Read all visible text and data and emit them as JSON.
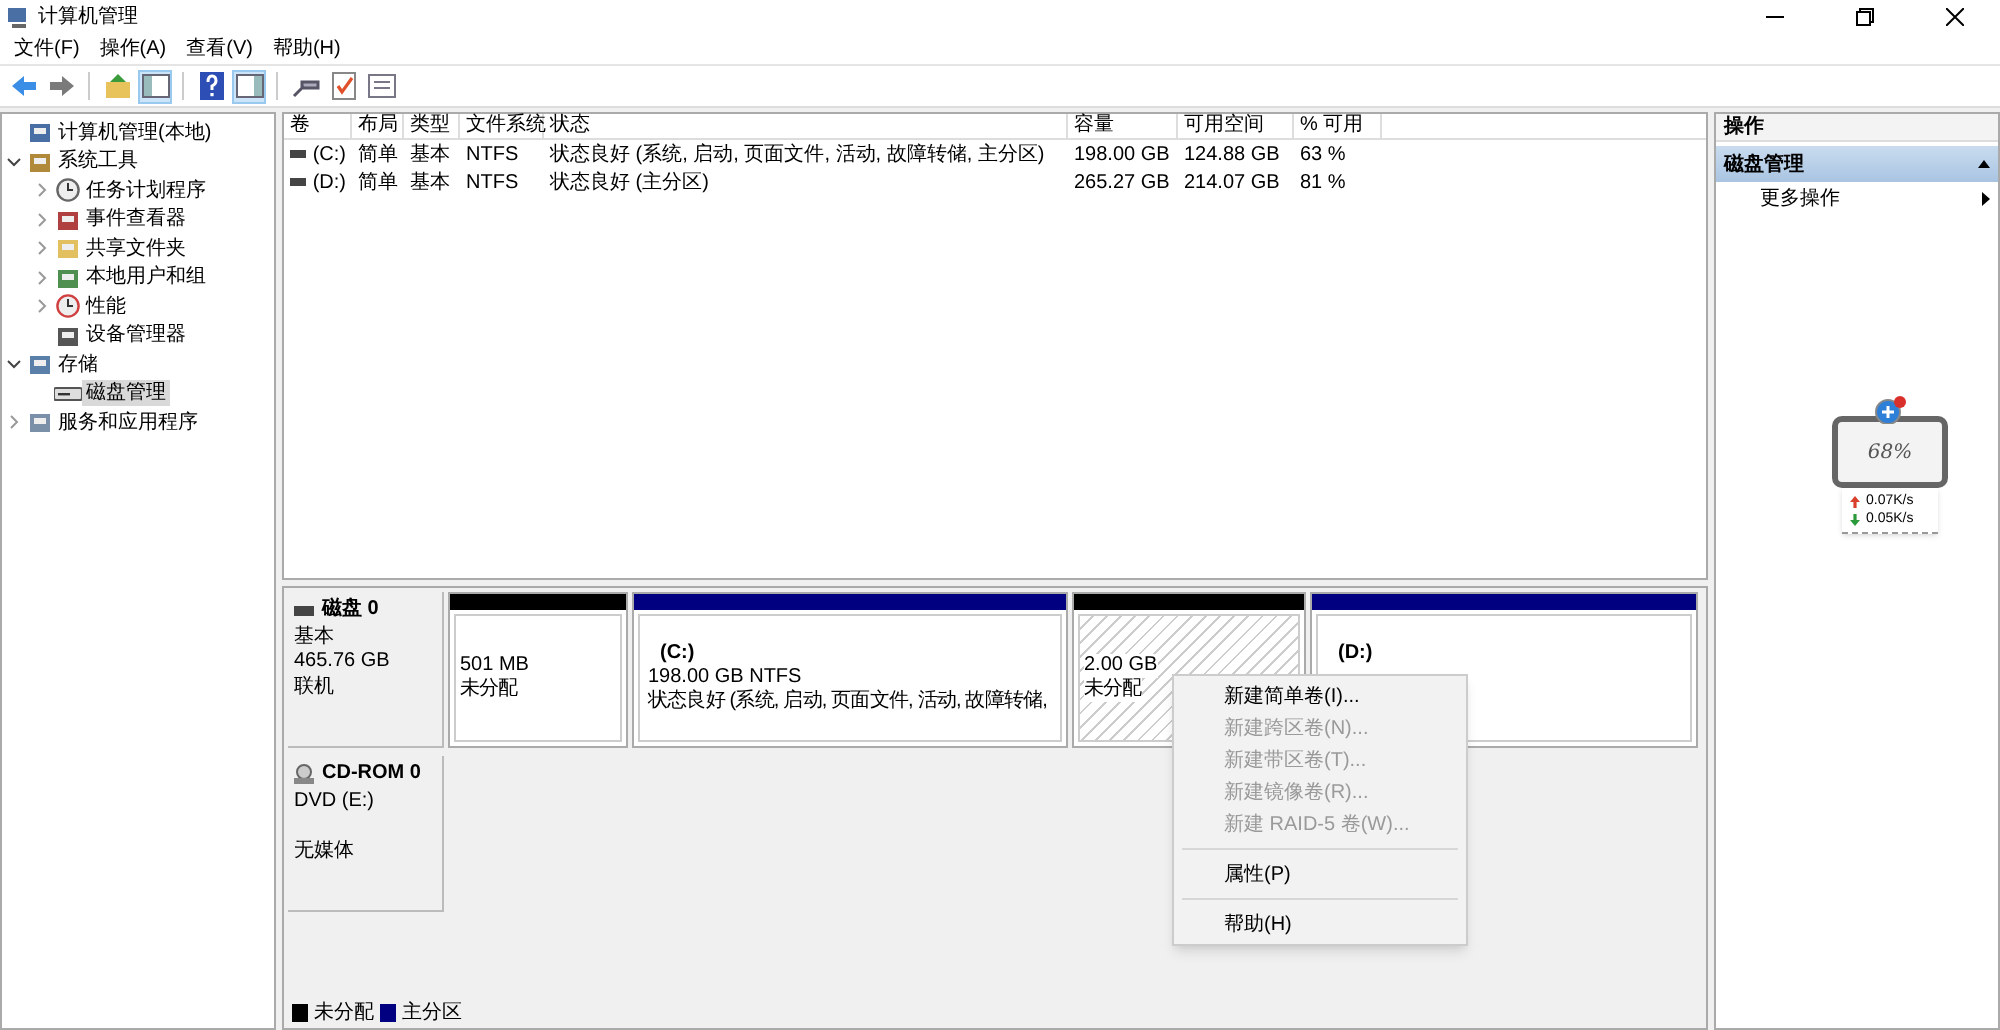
{
  "window": {
    "title": "计算机管理"
  },
  "menu_bar": [
    "文件(F)",
    "操作(A)",
    "查看(V)",
    "帮助(H)"
  ],
  "toolbar": [
    {
      "kind": "back",
      "selected": false
    },
    {
      "kind": "forward",
      "selected": false
    },
    {
      "kind": "separator"
    },
    {
      "kind": "up",
      "selected": false
    },
    {
      "kind": "tree",
      "selected": true
    },
    {
      "kind": "separator"
    },
    {
      "kind": "help",
      "selected": false
    },
    {
      "kind": "pane",
      "selected": true
    },
    {
      "kind": "separator"
    },
    {
      "kind": "connect",
      "selected": false
    },
    {
      "kind": "check",
      "selected": false
    },
    {
      "kind": "list",
      "selected": false
    }
  ],
  "tree": [
    {
      "label": "计算机管理(本地)",
      "selected": false
    },
    {
      "label": "系统工具",
      "expanded": true,
      "selected": false,
      "children": [
        {
          "label": "任务计划程序",
          "expanded": false,
          "selected": false
        },
        {
          "label": "事件查看器",
          "expanded": false,
          "selected": false
        },
        {
          "label": "共享文件夹",
          "expanded": false,
          "selected": false
        },
        {
          "label": "本地用户和组",
          "expanded": false,
          "selected": false
        },
        {
          "label": "性能",
          "expanded": false,
          "selected": false
        },
        {
          "label": "设备管理器",
          "selected": false
        }
      ]
    },
    {
      "label": "存储",
      "expanded": true,
      "selected": false,
      "children": [
        {
          "label": "磁盘管理",
          "selected": true
        }
      ]
    },
    {
      "label": "服务和应用程序",
      "expanded": false,
      "selected": false
    }
  ],
  "volume_table": {
    "columns": [
      "卷",
      "布局",
      "类型",
      "文件系统",
      "状态",
      "容量",
      "可用空间",
      "% 可用"
    ],
    "rows": [
      [
        "(C:)",
        "简单",
        "基本",
        "NTFS",
        "状态良好 (系统, 启动, 页面文件, 活动, 故障转储, 主分区)",
        "198.00 GB",
        "124.88 GB",
        "63 %"
      ],
      [
        "(D:)",
        "简单",
        "基本",
        "NTFS",
        "状态良好 (主分区)",
        "265.27 GB",
        "214.07 GB",
        "81 %"
      ]
    ]
  },
  "disks": [
    {
      "name": "磁盘 0",
      "kind": "disk",
      "line_groups": [
        [
          "基本",
          "465.76 GB",
          "联机"
        ]
      ],
      "partitions": [
        {
          "kind": "unallocated",
          "size": "501 MB",
          "status": "未分配",
          "hatched": false
        },
        {
          "kind": "primary",
          "label": "(C:)",
          "size": "198.00 GB NTFS",
          "status": "状态良好 (系统, 启动, 页面文件, 活动, 故障转储,",
          "hatched": false
        },
        {
          "kind": "unallocated",
          "size": "2.00 GB",
          "status": "未分配",
          "hatched": true
        },
        {
          "kind": "primary",
          "label": "(D:)",
          "hatched": false
        }
      ]
    },
    {
      "name": "CD-ROM 0",
      "kind": "cdrom",
      "line_groups": [
        [
          "DVD (E:)"
        ],
        [
          "无媒体"
        ]
      ]
    }
  ],
  "legend": [
    {
      "label": "未分配",
      "color": "#000000"
    },
    {
      "label": "主分区",
      "color": "#000080"
    }
  ],
  "context_menu": [
    {
      "kind": "item",
      "label": "新建简单卷(I)...",
      "disabled": false
    },
    {
      "kind": "item",
      "label": "新建跨区卷(N)...",
      "disabled": true
    },
    {
      "kind": "item",
      "label": "新建带区卷(T)...",
      "disabled": true
    },
    {
      "kind": "item",
      "label": "新建镜像卷(R)...",
      "disabled": true
    },
    {
      "kind": "item",
      "label": "新建 RAID-5 卷(W)...",
      "disabled": true
    },
    {
      "kind": "separator"
    },
    {
      "kind": "item",
      "label": "属性(P)",
      "disabled": false
    },
    {
      "kind": "separator"
    },
    {
      "kind": "item",
      "label": "帮助(H)",
      "disabled": false
    }
  ],
  "actions": {
    "title": "操作",
    "section": "磁盘管理",
    "items": [
      "更多操作"
    ]
  },
  "speed_widget": {
    "percent": "68%",
    "upload": "0.07K/s",
    "download": "0.05K/s"
  }
}
